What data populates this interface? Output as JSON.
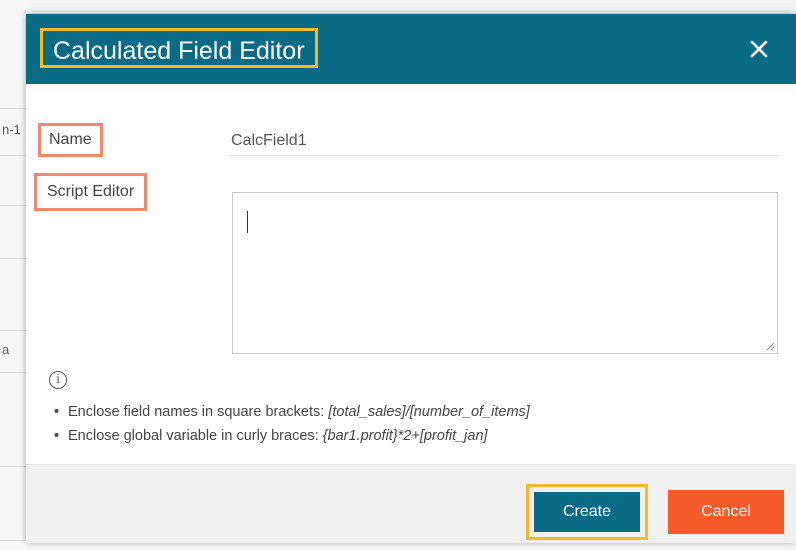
{
  "background": {
    "fragment_top": "n-1",
    "fragment_mid": "a"
  },
  "dialog": {
    "title": "Calculated Field Editor",
    "close_icon": "close-icon",
    "name_label": "Name",
    "name_value": "CalcField1",
    "script_label": "Script Editor",
    "script_value": "",
    "info_icon": "info-icon",
    "hints": [
      {
        "text": "Enclose field names in square brackets: ",
        "example": "[total_sales]/[number_of_items]"
      },
      {
        "text": "Enclose global variable in curly braces: ",
        "example": "{bar1.profit}*2+[profit_jan]"
      }
    ],
    "create_label": "Create",
    "cancel_label": "Cancel"
  },
  "colors": {
    "header": "#0b6a86",
    "highlight_title": "#f3b928",
    "highlight_label": "#ec8a6a",
    "cancel": "#f45a2a"
  }
}
